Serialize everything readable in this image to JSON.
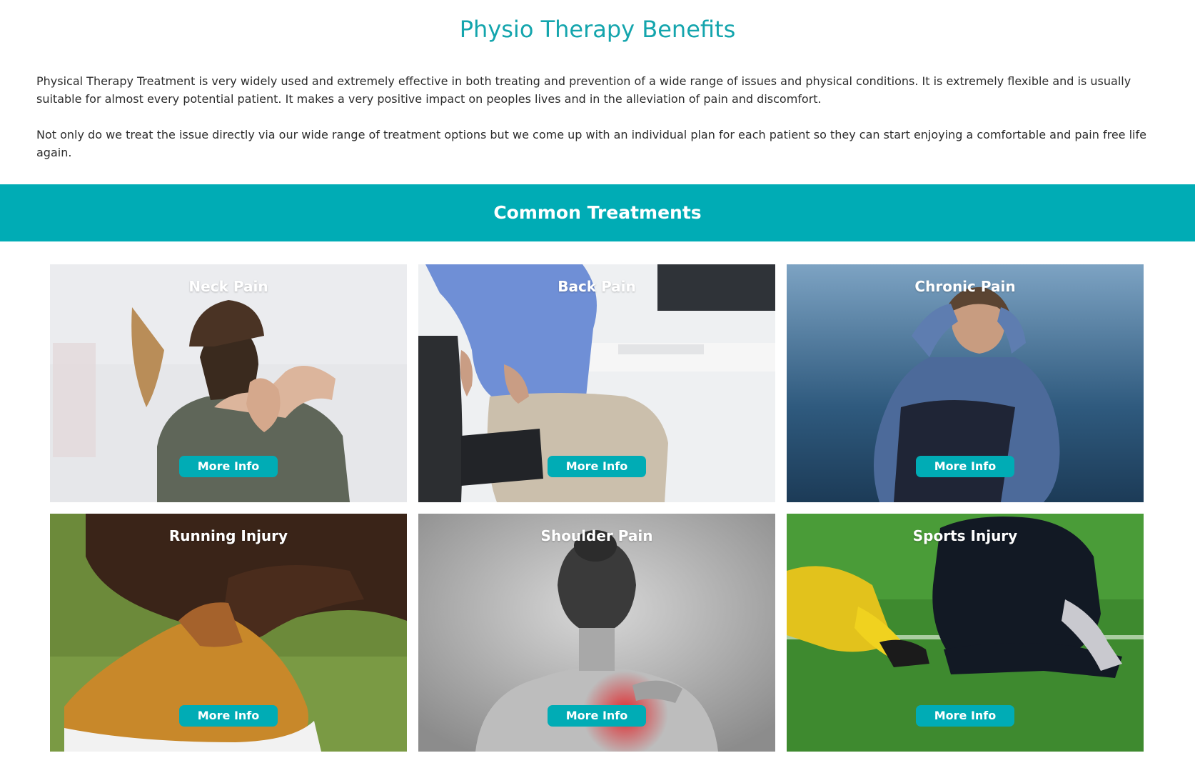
{
  "page": {
    "title": "Physio Therapy Benefits",
    "intro_paragraphs": [
      "Physical Therapy Treatment is very widely used and extremely effective in both treating and prevention of a wide range of issues and physical conditions. It is extremely flexible and is usually suitable for almost every potential patient. It makes a very positive impact on peoples lives and in the alleviation of pain and discomfort.",
      "Not only do we treat the issue directly via our wide range of treatment options but we come up with an individual plan for each patient so they can start enjoying a comfortable and pain free life again."
    ]
  },
  "treatments": {
    "heading": "Common Treatments",
    "cards": [
      {
        "title": "Neck Pain",
        "button": "More Info"
      },
      {
        "title": "Back Pain",
        "button": "More Info"
      },
      {
        "title": "Chronic Pain",
        "button": "More Info"
      },
      {
        "title": "Running Injury",
        "button": "More Info"
      },
      {
        "title": "Shoulder Pain",
        "button": "More Info"
      },
      {
        "title": "Sports Injury",
        "button": "More Info"
      }
    ]
  },
  "colors": {
    "accent": "#00acb5",
    "title": "#14a5ad",
    "body_text": "#2c2c2c"
  }
}
